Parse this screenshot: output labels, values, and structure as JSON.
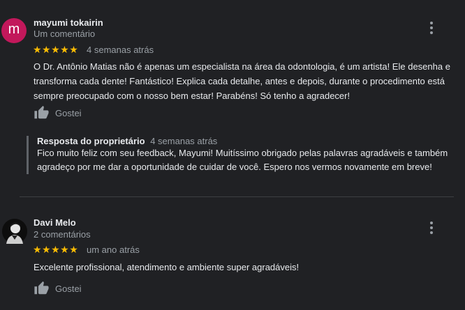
{
  "reviews": [
    {
      "avatar_letter": "m",
      "avatar_color": "#c2185b",
      "name": "mayumi tokairin",
      "meta": "Um comentário",
      "stars": "★★★★★",
      "rating": 5,
      "time": "4 semanas atrás",
      "text": "O Dr. Antônio Matias não é apenas um especialista na área da odontologia, é um artista! Ele desenha e transforma cada dente! Fantástico! Explica cada detalhe, antes e depois, durante o procedimento está sempre preocupado com o nosso bem estar! Parabéns! Só tenho a agradecer!",
      "like_label": "Gostei",
      "reply": {
        "title": "Resposta do proprietário",
        "time": "4 semanas atrás",
        "text": "Fico muito feliz com seu feedback, Mayumi! Muitíssimo obrigado pelas palavras agradáveis e também agradeço por me dar a oportunidade de cuidar de você. Espero nos vermos novamente em breve!"
      }
    },
    {
      "name": "Davi Melo",
      "meta": "2 comentários",
      "stars": "★★★★★",
      "rating": 5,
      "time": "um ano atrás",
      "text": "Excelente profissional, atendimento e ambiente super agradáveis!",
      "like_label": "Gostei"
    }
  ]
}
